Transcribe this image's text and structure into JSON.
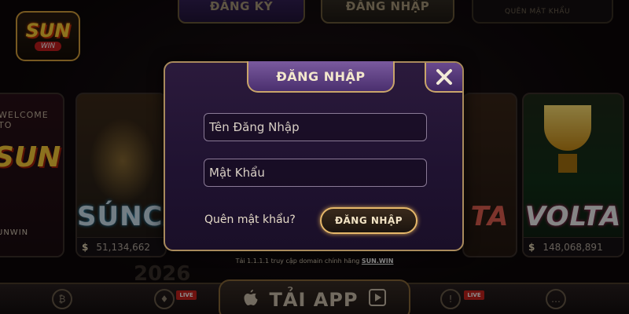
{
  "header": {
    "register_tab": "ĐĂNG KÝ",
    "login_tab": "ĐĂNG NHẬP",
    "small_tab": "QUÊN MẬT KHẨU"
  },
  "logo": {
    "main": "SUN",
    "sub": "WIN"
  },
  "games": [
    {
      "name": "welcome",
      "welcome_text": "WELCOME TO",
      "logo_text": "SUN",
      "brand": "UNWIN"
    },
    {
      "name": "sun-ca",
      "caption": "SÚNCA",
      "jackpot": "51,134,662"
    },
    {
      "name": "mid",
      "caption": "TA"
    },
    {
      "name": "volta",
      "caption": "VOLTA",
      "jackpot": "148,068,891"
    }
  ],
  "jackpot_symbol": "$",
  "domain_note": {
    "prefix": "Tải 1.1.1.1 truy cập domain chính hãng",
    "domain": "SUN.WIN"
  },
  "background_year": "2026",
  "bottom_bar": {
    "app_label": "TẢI APP",
    "live_badge": "LIVE"
  },
  "modal": {
    "title": "ĐĂNG NHẬP",
    "username_placeholder": "Tên Đăng Nhập",
    "password_placeholder": "Mật Khẩu",
    "forgot_label": "Quên mật khẩu?",
    "submit_label": "ĐĂNG NHẬP"
  },
  "colors": {
    "modal_bg": "#2b1a3c",
    "gold_border": "#c9a56a",
    "accent_purple": "#7a5a9e"
  }
}
